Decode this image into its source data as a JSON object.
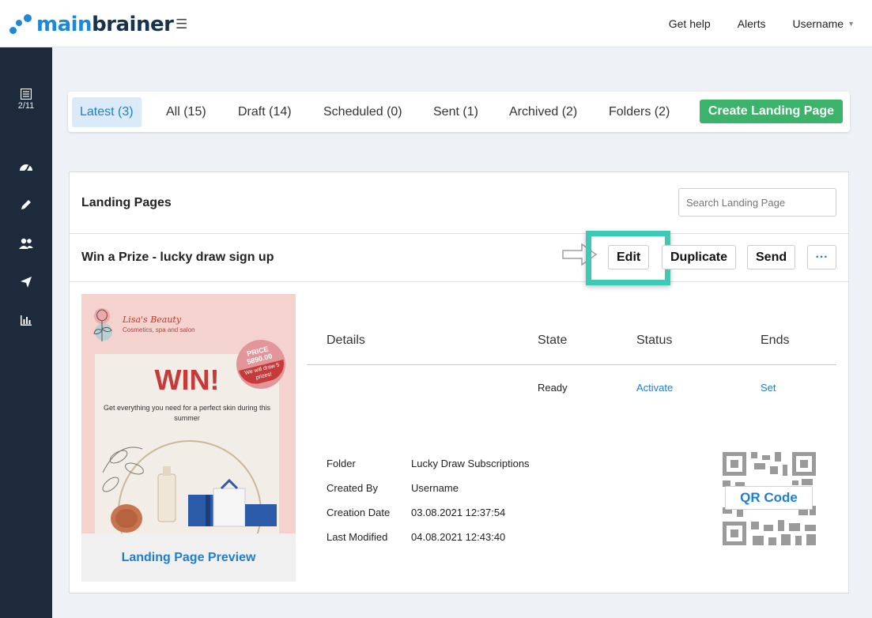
{
  "brand": {
    "name_light": "main",
    "name_bold": "brainer"
  },
  "header": {
    "menu_icon": "hamburger-icon",
    "links": [
      "Get help",
      "Alerts"
    ],
    "user": "Username"
  },
  "sidebar": {
    "items": [
      {
        "icon": "list-icon",
        "label": "2/11"
      },
      {
        "icon": "dashboard-icon"
      },
      {
        "icon": "pencil-icon"
      },
      {
        "icon": "users-icon"
      },
      {
        "icon": "paper-plane-icon"
      },
      {
        "icon": "bar-chart-icon"
      }
    ]
  },
  "tabs": [
    {
      "label": "Latest (3)",
      "active": true
    },
    {
      "label": "All (15)"
    },
    {
      "label": "Draft (14)"
    },
    {
      "label": "Scheduled (0)"
    },
    {
      "label": "Sent (1)"
    },
    {
      "label": "Archived (2)"
    },
    {
      "label": "Folders (2)"
    }
  ],
  "create_button": "Create Landing Page",
  "panel": {
    "title": "Landing Pages",
    "search_placeholder": "Search Landing Page"
  },
  "page": {
    "title": "Win a Prize - lucky draw sign up",
    "actions": {
      "edit": "Edit",
      "duplicate": "Duplicate",
      "send": "Send",
      "more": "···"
    },
    "preview": {
      "brand": "Lisa's Beauty",
      "tagline": "Cosmetics, spa and salon",
      "headline": "WIN!",
      "subtext": "Get everything you need for a perfect skin during this summer",
      "badge_price_label": "PRICE",
      "badge_price": "5890.00",
      "badge_note": "We will draw 5 prizes!",
      "link": "Landing Page Preview"
    },
    "details": {
      "headers": {
        "details": "Details",
        "state": "State",
        "status": "Status",
        "ends": "Ends"
      },
      "values": {
        "state": "Ready",
        "status": "Activate",
        "ends": "Set"
      }
    },
    "meta": [
      {
        "label": "Folder",
        "value": "Lucky Draw Subscriptions"
      },
      {
        "label": "Created By",
        "value": "Username"
      },
      {
        "label": "Creation Date",
        "value": "03.08.2021 12:37:54"
      },
      {
        "label": "Last Modified",
        "value": "04.08.2021 12:43:40"
      }
    ],
    "qr_label": "QR Code"
  },
  "colors": {
    "accent": "#1e7fd0",
    "create_button": "#3cb36a",
    "sidebar": "#1c2a3c",
    "highlight": "#3cc9b5"
  }
}
